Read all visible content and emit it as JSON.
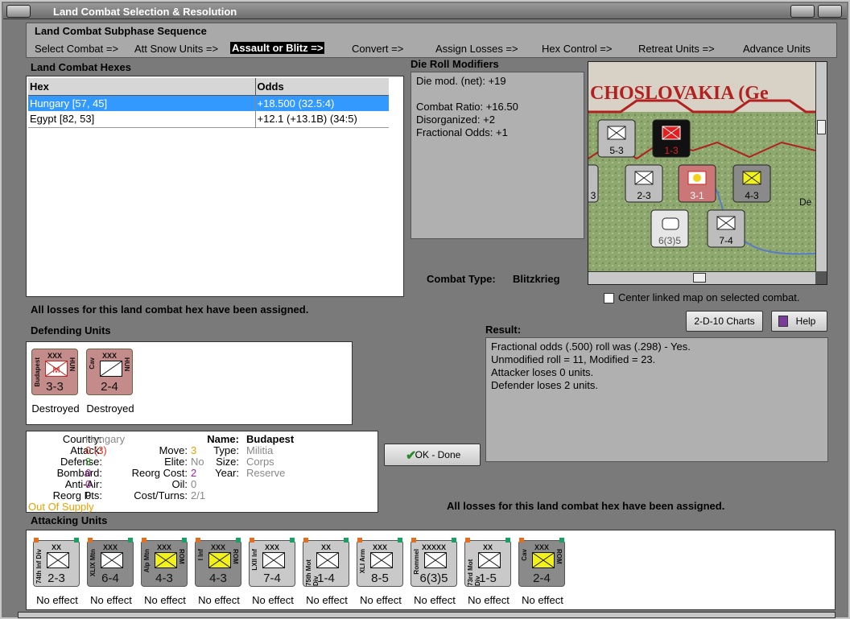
{
  "window": {
    "title": "Land Combat Selection & Resolution"
  },
  "sequence": {
    "title": "Land Combat Subphase Sequence",
    "steps": [
      "Select Combat =>",
      "Att Snow Units =>",
      "Assault or Blitz =>",
      "Convert =>",
      "Assign Losses =>",
      "Hex Control =>",
      "Retreat Units =>",
      "Advance Units"
    ]
  },
  "hexes": {
    "title": "Land Combat Hexes",
    "columns": [
      "Hex",
      "Odds"
    ],
    "rows": [
      {
        "hex": "Hungary [57, 45]",
        "odds": "+18.500 (32.5:4)"
      },
      {
        "hex": "Egypt [82, 53]",
        "odds": "+12.1 (+13.1B) (34:5)"
      }
    ]
  },
  "modifiers": {
    "title": "Die Roll Modifiers",
    "lines": [
      "Die mod. (net): +19",
      "",
      "Combat Ratio: +16.50",
      "Disorganized: +2",
      "Fractional Odds: +1"
    ]
  },
  "map": {
    "label": "CHOSLOVAKIA (Ge",
    "counters": [
      "5-3",
      "1-3",
      "3",
      "2-3",
      "3-1",
      "4-3",
      "6(3)5",
      "7-4",
      "De"
    ]
  },
  "combat_type": {
    "label": "Combat Type:",
    "value": "Blitzkrieg"
  },
  "center_map": {
    "label": "Center linked map on selected combat."
  },
  "buttons": {
    "charts": "2-D-10 Charts",
    "help": "Help",
    "ok": "OK - Done"
  },
  "losses_msg": "All losses for this land combat hex have been assigned.",
  "defending": {
    "title": "Defending Units",
    "units": [
      {
        "name": "Budapest",
        "size": "XXX",
        "nat": "HUN",
        "val": "3-3",
        "status": "Destroyed"
      },
      {
        "name": "Cav",
        "size": "XXX",
        "nat": "HUN",
        "val": "2-4",
        "status": "Destroyed"
      }
    ]
  },
  "result": {
    "title": "Result:",
    "lines": [
      "Fractional odds (.500) roll was (.298)  - Yes.",
      "Unmodified roll = 11, Modified = 23.",
      "Attacker loses 0 units.",
      "Defender loses 2 units."
    ]
  },
  "details": {
    "country_l": "Country:",
    "country": "Hungary",
    "attack_l": "Attack:",
    "attack": "0",
    "attack2": "(3)",
    "defense_l": "Defense:",
    "defense": "3",
    "bombard_l": "Bombard:",
    "bombard": "0",
    "antiair_l": "Anti-Air:",
    "antiair": "0",
    "reorgpts_l": "Reorg Pts:",
    "reorgpts": "0",
    "supply": "Out Of Supply",
    "move_l": "Move:",
    "move": "3",
    "elite_l": "Elite:",
    "elite": "No",
    "reorgcost_l": "Reorg Cost:",
    "reorgcost": "2",
    "oil_l": "Oil:",
    "oil": "0",
    "costturns_l": "Cost/Turns:",
    "costturns": "2/1",
    "name_l": "Name:",
    "name": "Budapest",
    "type_l": "Type:",
    "type": "Militia",
    "size_l": "Size:",
    "size": "Corps",
    "year_l": "Year:",
    "year": "Reserve"
  },
  "attacking": {
    "title": "Attacking Units",
    "units": [
      {
        "name": "74th Inf Div",
        "size": "XX",
        "nat": "",
        "val": "2-3",
        "status": "No effect",
        "bg": "#c9c9c9",
        "fill": "#fff"
      },
      {
        "name": "XLIX Mtn",
        "size": "XXX",
        "nat": "",
        "val": "6-4",
        "status": "No effect",
        "bg": "#8a8a8a",
        "fill": "#fff"
      },
      {
        "name": "Alp Mtn",
        "size": "XXX",
        "nat": "ROM",
        "val": "4-3",
        "status": "No effect",
        "bg": "#8a8a8a",
        "fill": "#f2f21a"
      },
      {
        "name": "I Inf",
        "size": "XXX",
        "nat": "ROM",
        "val": "4-3",
        "status": "No effect",
        "bg": "#8a8a8a",
        "fill": "#f2f21a"
      },
      {
        "name": "LXII Inf",
        "size": "XXX",
        "nat": "",
        "val": "7-4",
        "status": "No effect",
        "bg": "#c9c9c9",
        "fill": "#fff"
      },
      {
        "name": "75th Mot Div",
        "size": "XX",
        "nat": "",
        "val": "1-4",
        "status": "No effect",
        "bg": "#c9c9c9",
        "fill": "#fff"
      },
      {
        "name": "XLI Arm",
        "size": "XXX",
        "nat": "",
        "val": "8-5",
        "status": "No effect",
        "bg": "#c9c9c9",
        "fill": "#fff"
      },
      {
        "name": "Rommel",
        "size": "XXXXX",
        "nat": "",
        "val": "6(3)5",
        "status": "No effect",
        "bg": "#c9c9c9",
        "fill": "#fff"
      },
      {
        "name": "73rd Mot Div",
        "size": "XX",
        "nat": "",
        "val": "1-5",
        "status": "No effect",
        "bg": "#c9c9c9",
        "fill": "#fff"
      },
      {
        "name": "Cav",
        "size": "XXX",
        "nat": "ROM",
        "val": "2-4",
        "status": "No effect",
        "bg": "#8a8a8a",
        "fill": "#f2f21a"
      }
    ]
  },
  "colors": {
    "selected_row": "#3399ff",
    "supply": "#e8a000",
    "attack_value": "#e0301e",
    "purple": "#a020a0",
    "dim": "#888888"
  }
}
